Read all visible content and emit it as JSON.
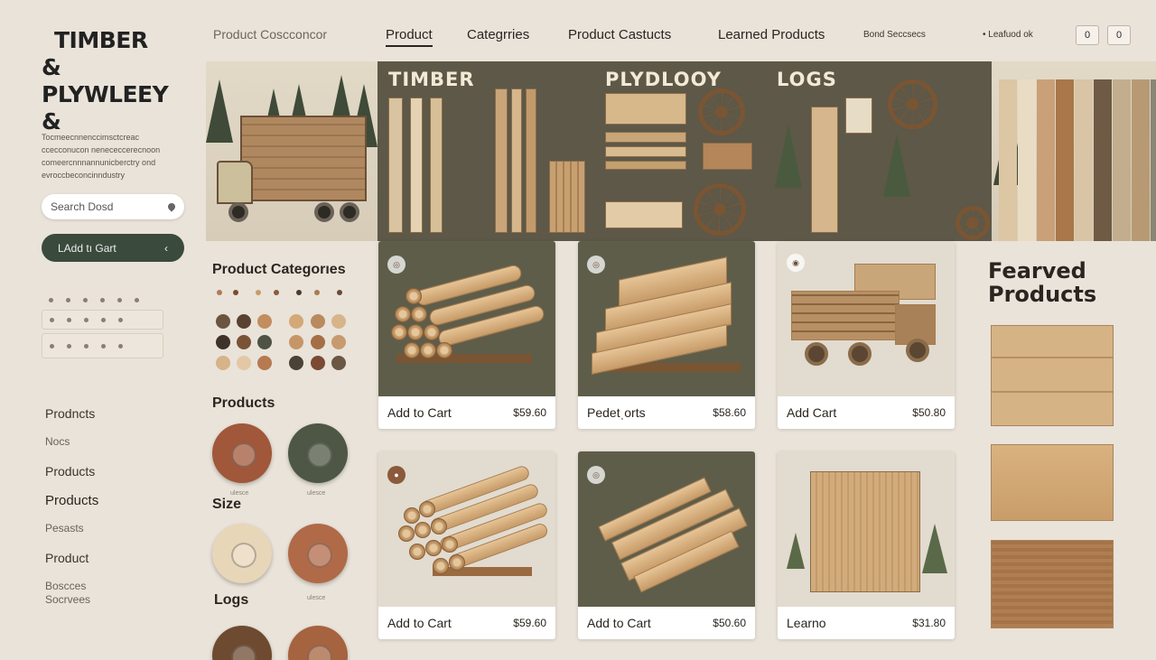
{
  "brand": {
    "line1": "TIMBER",
    "line2": "& PLYWLEEY",
    "line3": "&"
  },
  "tagline": "Tocmeecnnenccimsctcreac ccecconucon nenececcerecnoon comeercnnnannunicberctry ond evroccbeconcinndustry",
  "search": {
    "value": "Search Dosd"
  },
  "cta": {
    "label": "LAdd tı Gart",
    "arrow": "‹"
  },
  "sidebar": {
    "nav": [
      {
        "label": "Prodncts"
      },
      {
        "label": "Nocs"
      },
      {
        "label": "Products"
      },
      {
        "label": "Products"
      },
      {
        "label": "Pesasts"
      },
      {
        "label": "Product"
      },
      {
        "label": "Boscces Socrvees"
      }
    ]
  },
  "topnav": {
    "breadcrumb": "Product Coscconcor",
    "tabs": [
      {
        "label": "Product",
        "active": true
      },
      {
        "label": "Categrries"
      },
      {
        "label": "Product Castucts"
      },
      {
        "label": "Learned Products"
      }
    ],
    "small_link": "Bond Seccsecs",
    "account_link": "Leafuod ok",
    "icon_btn_1": "0",
    "icon_btn_2": "0"
  },
  "hero": {
    "titles": {
      "timber": "TIMBER",
      "plywood": "PLYDLOOY",
      "logs": "LOGS"
    }
  },
  "midcol": {
    "categories_heading": "Product Categorıes",
    "products_heading": "Products",
    "size_heading": "Size",
    "logs_heading": "Logs",
    "ring_caption": "ulesce"
  },
  "products": [
    {
      "label": "Add to Cart",
      "price": "$59.60",
      "theme": "dark"
    },
    {
      "label": "Pedetˌorts",
      "price": "$58.60",
      "theme": "dark"
    },
    {
      "label": "Add Cart",
      "price": "$50.80",
      "theme": "light"
    },
    {
      "label": "Add to Cart",
      "price": "$59.60",
      "theme": "light"
    },
    {
      "label": "Add to Cart",
      "price": "$50.60",
      "theme": "dark"
    },
    {
      "label": "Learno",
      "price": "$31.80",
      "theme": "light"
    }
  ],
  "featured": {
    "title": "Fearved Products"
  },
  "colors": {
    "background": "#e9e3d9",
    "accent_dark_green": "#3a4a3c",
    "wood_light": "#d9b78a",
    "wood_mid": "#b58659",
    "wood_dark": "#7a5533",
    "banner_dark": "#5d5848"
  },
  "icons": [
    "location-pin-icon",
    "chevron-left-icon",
    "badge-icon",
    "account-icon"
  ]
}
